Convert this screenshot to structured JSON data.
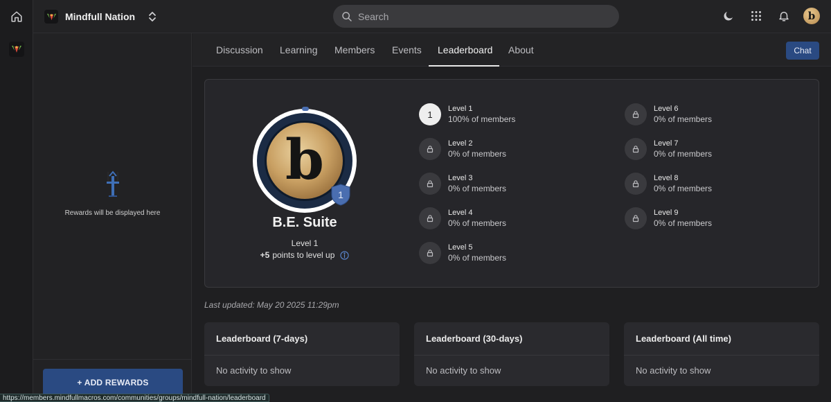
{
  "app": {
    "community_name": "Mindfull Nation"
  },
  "search": {
    "placeholder": "Search"
  },
  "left_panel": {
    "rewards_empty_text": "Rewards will be displayed here",
    "add_rewards_label": "+ ADD REWARDS"
  },
  "tabs": [
    {
      "label": "Discussion",
      "active": false
    },
    {
      "label": "Learning",
      "active": false
    },
    {
      "label": "Members",
      "active": false
    },
    {
      "label": "Events",
      "active": false
    },
    {
      "label": "Leaderboard",
      "active": true
    },
    {
      "label": "About",
      "active": false
    }
  ],
  "chat_label": "Chat",
  "profile": {
    "name": "B.E. Suite",
    "avatar_letter": "b",
    "badge_level": "1",
    "level_label": "Level 1",
    "points_value": "+5",
    "points_text": "points to level up",
    "level_progress_fraction": 0.0
  },
  "levels": [
    {
      "badge": "1",
      "name": "Level 1",
      "members": "100% of members",
      "locked": false,
      "current": true
    },
    {
      "badge": "",
      "name": "Level 2",
      "members": "0% of members",
      "locked": true,
      "current": false
    },
    {
      "badge": "",
      "name": "Level 3",
      "members": "0% of members",
      "locked": true,
      "current": false
    },
    {
      "badge": "",
      "name": "Level 4",
      "members": "0% of members",
      "locked": true,
      "current": false
    },
    {
      "badge": "",
      "name": "Level 5",
      "members": "0% of members",
      "locked": true,
      "current": false
    },
    {
      "badge": "",
      "name": "Level 6",
      "members": "0% of members",
      "locked": true,
      "current": false
    },
    {
      "badge": "",
      "name": "Level 7",
      "members": "0% of members",
      "locked": true,
      "current": false
    },
    {
      "badge": "",
      "name": "Level 8",
      "members": "0% of members",
      "locked": true,
      "current": false
    },
    {
      "badge": "",
      "name": "Level 9",
      "members": "0% of members",
      "locked": true,
      "current": false
    }
  ],
  "last_updated": "Last updated: May 20 2025 11:29pm",
  "leaderboards": [
    {
      "title": "Leaderboard (7-days)",
      "empty_text": "No activity to show"
    },
    {
      "title": "Leaderboard (30-days)",
      "empty_text": "No activity to show"
    },
    {
      "title": "Leaderboard (All time)",
      "empty_text": "No activity to show"
    }
  ],
  "status_bar_url": "https://members.mindfullmacros.com/communities/groups/mindfull-nation/leaderboard",
  "icons": {
    "home": "home-icon",
    "switcher": "chevron-updown-icon",
    "search": "search-icon",
    "theme": "moon-icon",
    "apps": "grid-icon",
    "notifications": "bell-icon",
    "lock": "lock-icon",
    "info": "info-icon",
    "reward": "reward-icon",
    "level_badge": "shield-badge-icon"
  },
  "colors": {
    "accent": "#2a4a82",
    "badge": "#4a6eb0",
    "gold": "#c9a063"
  }
}
